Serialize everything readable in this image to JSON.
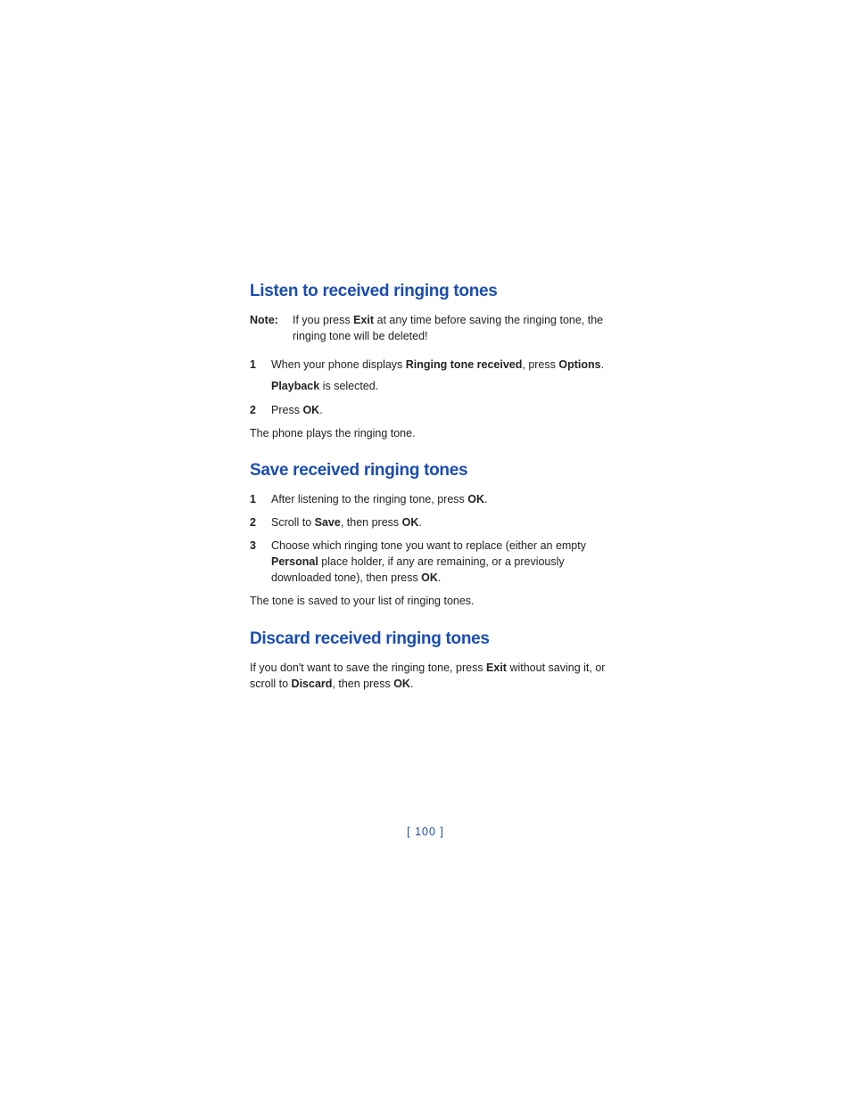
{
  "sections": {
    "listen": {
      "heading": "Listen to received ringing tones",
      "note_label": "Note:",
      "note_pre": "If you press ",
      "note_exit": "Exit",
      "note_post": " at any time before saving the ringing tone, the ringing tone will be deleted!",
      "step1_num": "1",
      "step1_pre": "When your phone displays ",
      "step1_rt": "Ringing tone received",
      "step1_mid": ", press ",
      "step1_opt": "Options",
      "step1_end": ".",
      "step1_sub_pre": "",
      "step1_sub_pb": "Playback",
      "step1_sub_post": " is selected.",
      "step2_num": "2",
      "step2_pre": "Press ",
      "step2_ok": "OK",
      "step2_end": ".",
      "after": "The phone plays the ringing tone."
    },
    "save": {
      "heading": "Save received ringing tones",
      "step1_num": "1",
      "step1_pre": "After listening to the ringing tone, press ",
      "step1_ok": "OK",
      "step1_end": ".",
      "step2_num": "2",
      "step2_pre": "Scroll to ",
      "step2_save": "Save",
      "step2_mid": ", then press ",
      "step2_ok": "OK",
      "step2_end": ".",
      "step3_num": "3",
      "step3_pre": "Choose which ringing tone you want to replace (either an empty ",
      "step3_personal": "Personal",
      "step3_mid": " place holder, if any are remaining, or a previously downloaded tone), then press ",
      "step3_ok": "OK",
      "step3_end": ".",
      "after": "The tone is saved to your list of ringing tones."
    },
    "discard": {
      "heading": "Discard received ringing tones",
      "body_pre": "If you don't want to save the ringing tone, press ",
      "body_exit": "Exit",
      "body_mid": " without saving it, or scroll to ",
      "body_discard": "Discard",
      "body_mid2": ", then press ",
      "body_ok": "OK",
      "body_end": "."
    }
  },
  "page_number": "[ 100 ]"
}
